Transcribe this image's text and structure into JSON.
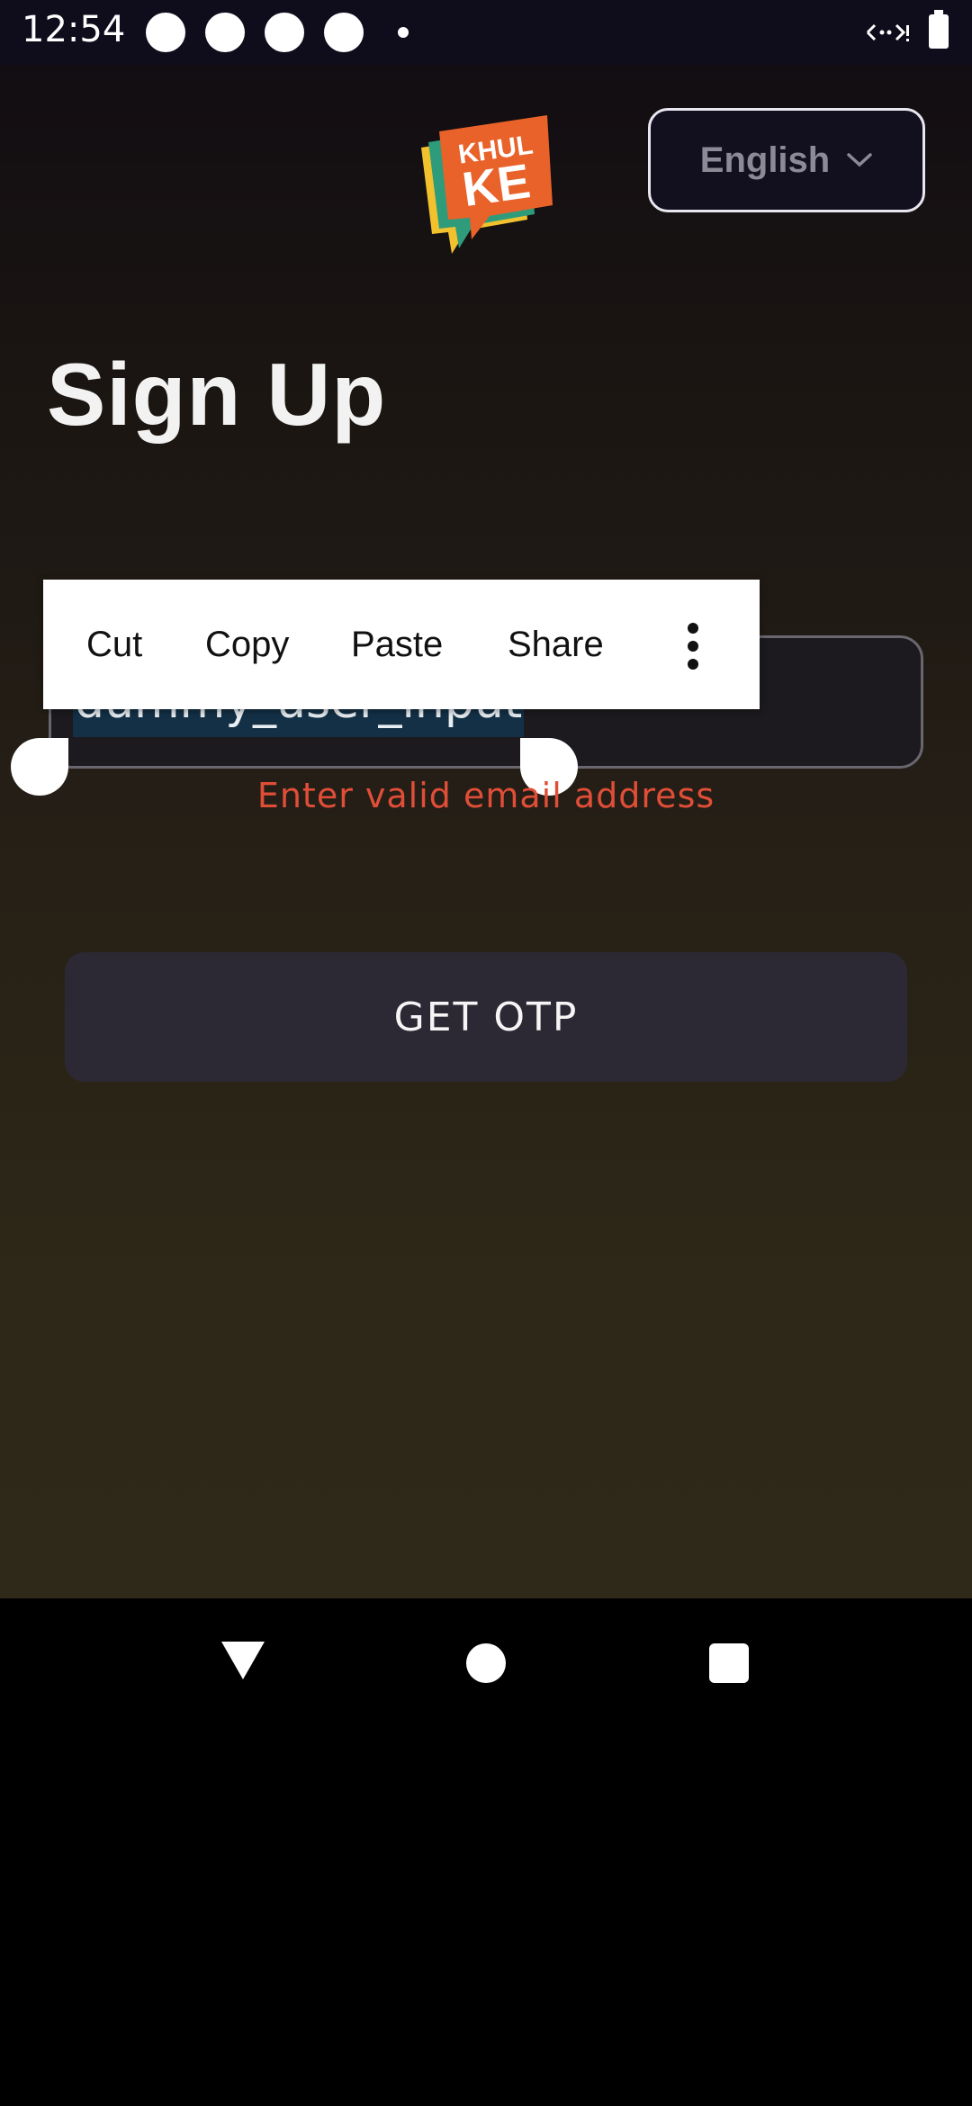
{
  "status_bar": {
    "time": "12:54",
    "signal_icon": "wifi-off-icon"
  },
  "header": {
    "language_label": "English"
  },
  "logo": {
    "line1": "KHUL",
    "line2": "KE",
    "colors": [
      "#e8622a",
      "#f2c12e",
      "#2e9c7a",
      "#6bb59a"
    ]
  },
  "page": {
    "title": "Sign Up"
  },
  "form": {
    "email_value": "dummy_user_input",
    "error_text": "Enter valid email address",
    "submit_label": "GET OTP"
  },
  "context_menu": {
    "items": [
      "Cut",
      "Copy",
      "Paste",
      "Share"
    ],
    "more_icon": "more-vert-icon"
  },
  "colors": {
    "error": "#e04e38",
    "selection": "#133046",
    "button_bg": "#2c2834"
  }
}
